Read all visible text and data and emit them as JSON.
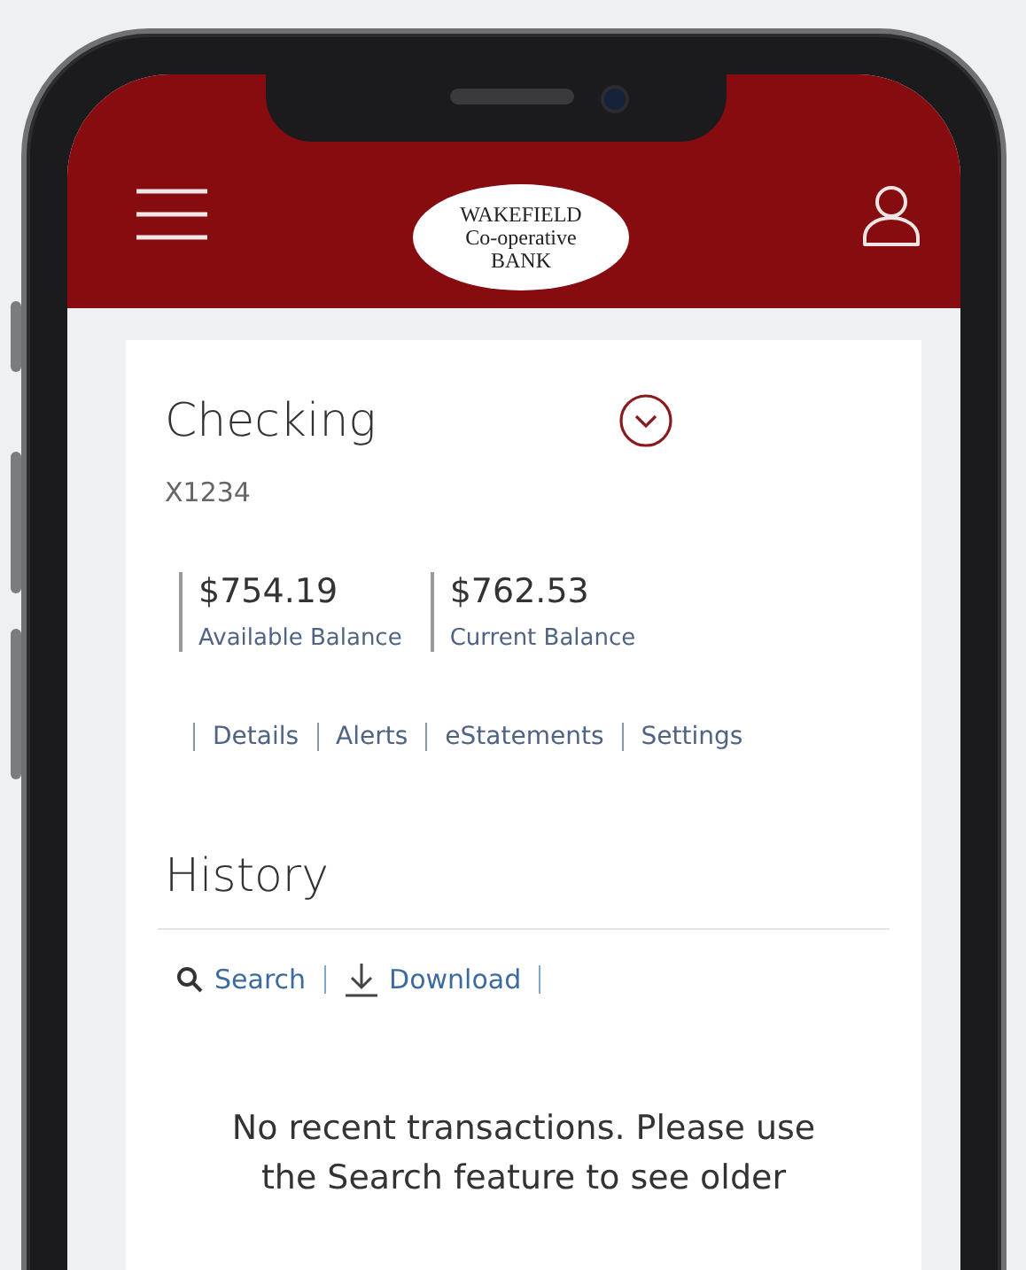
{
  "header": {
    "logo_lines": [
      "WAKEFIELD",
      "Co-operative",
      "BANK"
    ]
  },
  "account": {
    "title": "Checking",
    "number": "X1234",
    "balances": [
      {
        "amount": "$754.19",
        "label": "Available Balance"
      },
      {
        "amount": "$762.53",
        "label": "Current Balance"
      }
    ],
    "links": [
      "Details",
      "Alerts",
      "eStatements",
      "Settings"
    ]
  },
  "history": {
    "title": "History",
    "actions": [
      {
        "kind": "search",
        "label": "Search"
      },
      {
        "kind": "download",
        "label": "Download"
      }
    ],
    "empty_message": "No recent transactions. Please use the Search feature to see older"
  }
}
